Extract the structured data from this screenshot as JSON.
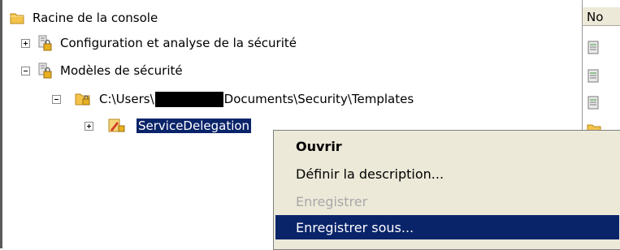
{
  "tree": {
    "root_label": "Racine de la console",
    "config_analysis_label": "Configuration et analyse de la sécurité",
    "templates_label": "Modèles de sécurité",
    "path_prefix": "C:\\Users\\",
    "path_suffix": "Documents\\Security\\Templates",
    "selected_label": "ServiceDelegation"
  },
  "right_pane": {
    "column_header": "No"
  },
  "context_menu": {
    "items": [
      {
        "label": "Ouvrir",
        "style": "default"
      },
      {
        "label": "Définir la description...",
        "style": "normal"
      },
      {
        "label": "Enregistrer",
        "style": "disabled"
      },
      {
        "label": "Enregistrer sous...",
        "style": "highlighted"
      }
    ]
  },
  "colors": {
    "selection": "#0a246a",
    "menu_bg": "#ece9d8",
    "folder": "#f4c34a",
    "disabled_text": "#a8a8a8"
  },
  "icons": [
    "folder-icon",
    "security-config-icon",
    "security-templates-icon",
    "template-folder-icon",
    "template-file-icon"
  ]
}
